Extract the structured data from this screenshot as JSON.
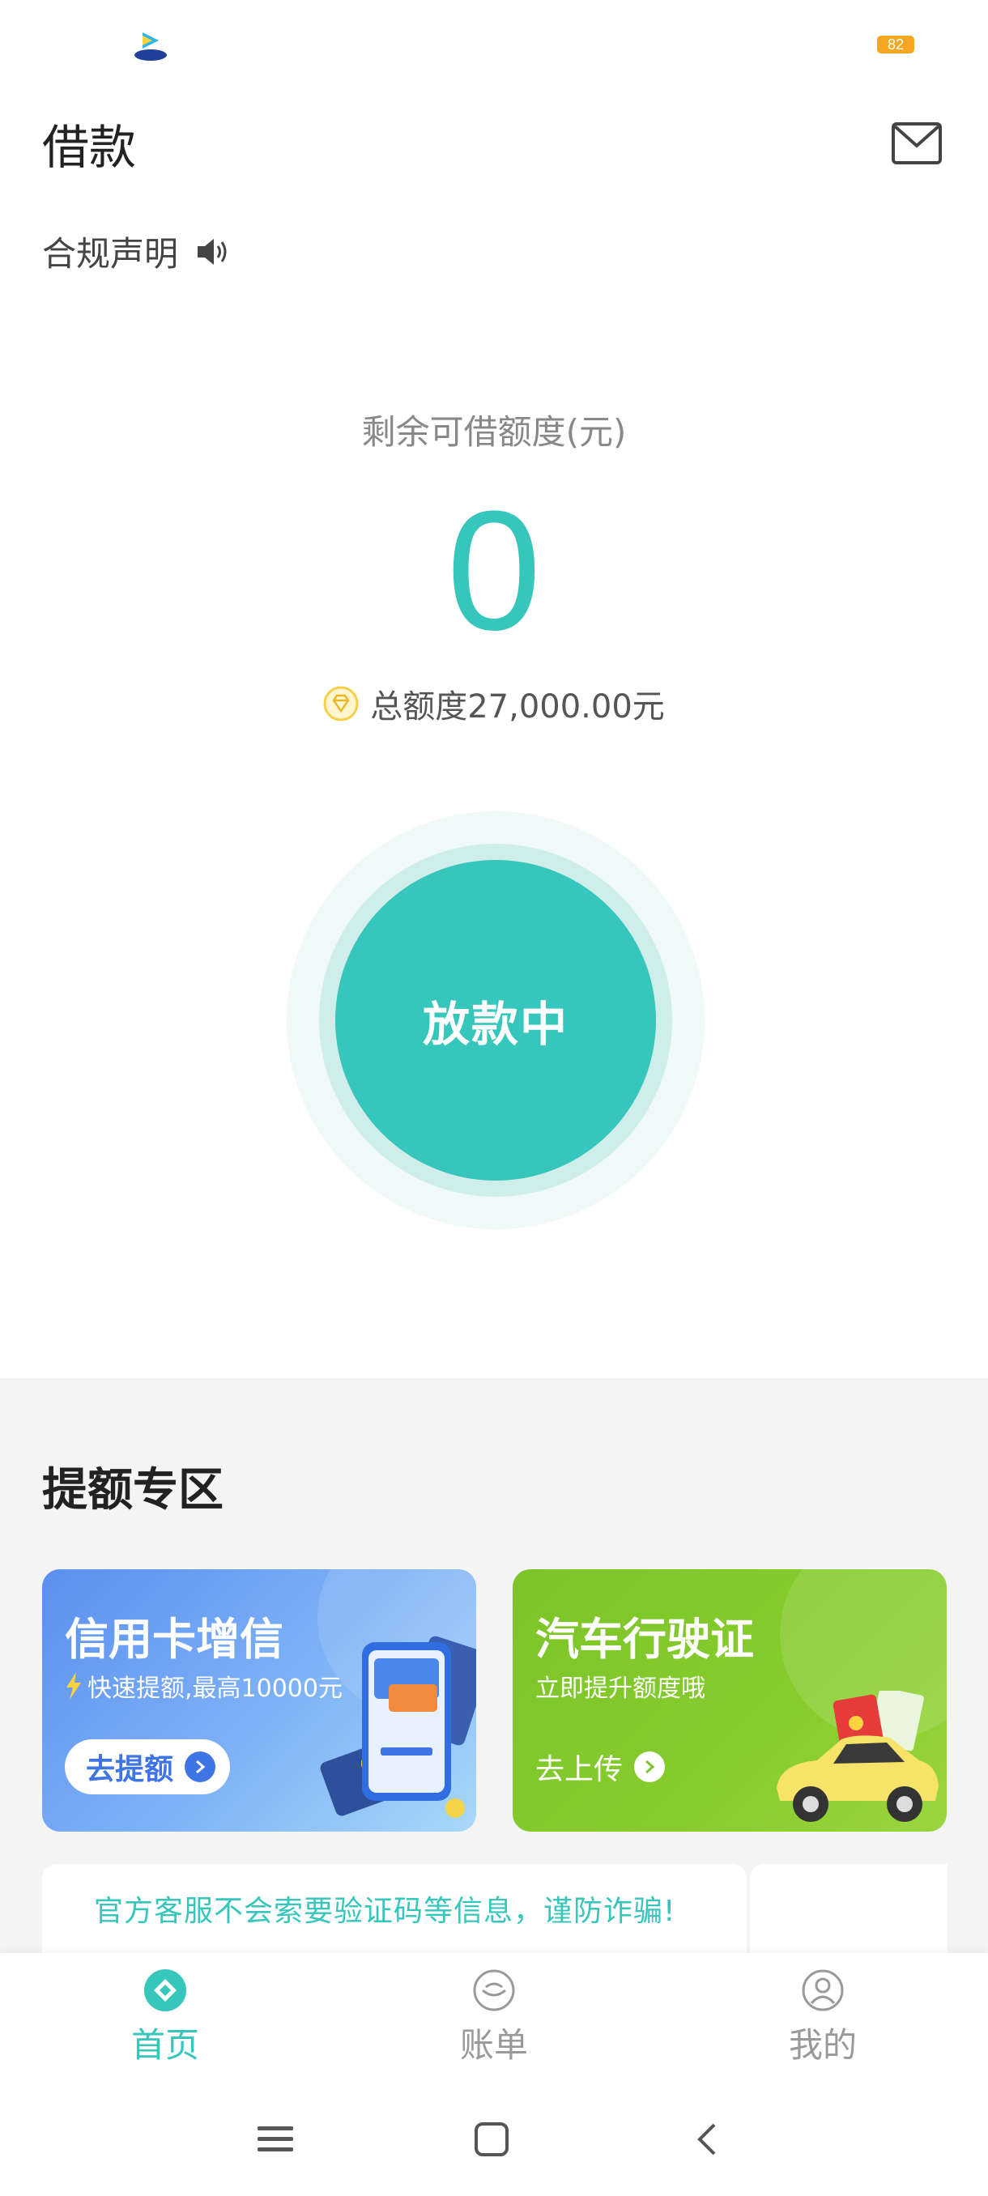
{
  "status_bar": {
    "battery": "82"
  },
  "header": {
    "title": "借款",
    "compliance_label": "合规声明"
  },
  "credit": {
    "label": "剩余可借额度(元)",
    "remaining": "0",
    "total_text": "总额度27,000.00元"
  },
  "main_button": {
    "label": "放款中"
  },
  "boost_zone": {
    "title": "提额专区",
    "cards": [
      {
        "title": "信用卡增信",
        "subtitle": "快速提额,最高10000元",
        "button": "去提额"
      },
      {
        "title": "汽车行驶证",
        "subtitle": "立即提升额度哦",
        "button": "去上传"
      }
    ]
  },
  "notice": {
    "text": "官方客服不会索要验证码等信息，谨防诈骗!"
  },
  "tabbar": {
    "items": [
      {
        "label": "首页",
        "icon": "home-icon",
        "active": true
      },
      {
        "label": "账单",
        "icon": "bill-icon",
        "active": false
      },
      {
        "label": "我的",
        "icon": "profile-icon",
        "active": false
      }
    ]
  },
  "colors": {
    "accent": "#37c6bb",
    "card_blue": "#5b8ff0",
    "card_green": "#7cc42a",
    "battery": "#f5a623",
    "inactive_tab": "#999999"
  }
}
